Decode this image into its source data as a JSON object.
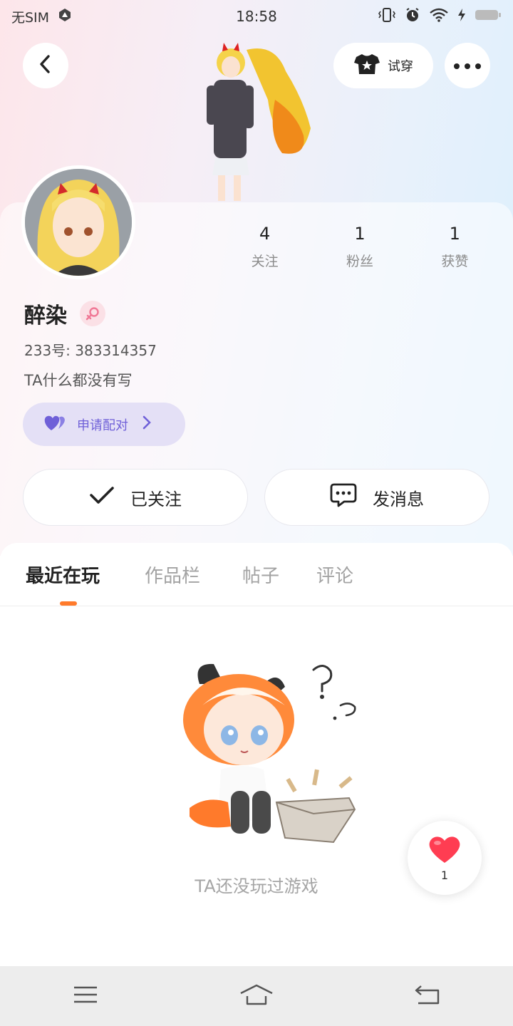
{
  "status_bar": {
    "carrier": "无SIM",
    "time": "18:58"
  },
  "header": {
    "tryon_label": "试穿"
  },
  "profile": {
    "stats": [
      {
        "value": "4",
        "label": "关注"
      },
      {
        "value": "1",
        "label": "粉丝"
      },
      {
        "value": "1",
        "label": "获赞"
      }
    ],
    "nickname": "醉染",
    "user_id": "233号: 383314357",
    "bio": "TA什么都没有写",
    "pair_label": "申请配对"
  },
  "actions": {
    "follow_label": "已关注",
    "message_label": "发消息"
  },
  "tabs": [
    {
      "label": "最近在玩",
      "active": true
    },
    {
      "label": "作品栏",
      "active": false
    },
    {
      "label": "帖子",
      "active": false
    },
    {
      "label": "评论",
      "active": false
    }
  ],
  "empty_state": {
    "text": "TA还没玩过游戏"
  },
  "like_float": {
    "count": "1"
  },
  "colors": {
    "accent_orange": "#ff7a2b",
    "pair_purple": "#6f60d8",
    "heart_red": "#ff3d52"
  }
}
